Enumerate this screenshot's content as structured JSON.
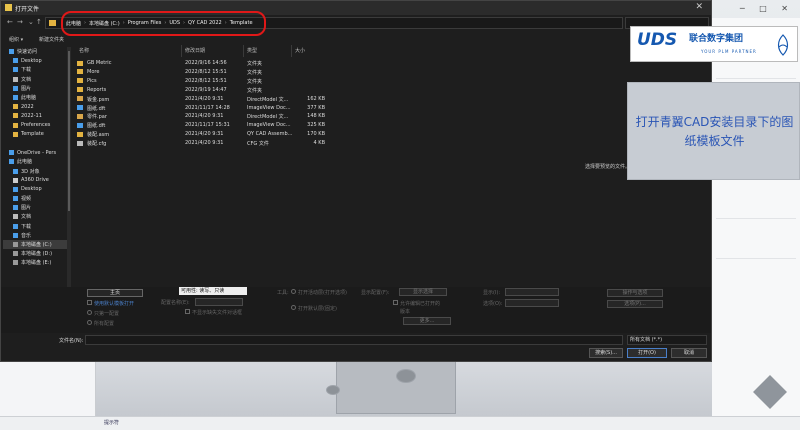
{
  "dialog": {
    "title": "打开文件",
    "close_glyph": "✕"
  },
  "nav": {
    "back": "←",
    "forward": "→",
    "dropdown": "⌄",
    "up": "↑"
  },
  "address": {
    "crumbs": [
      "此电脑",
      "本地磁盘 (C:)",
      "Program Files",
      "UDS",
      "QY CAD 2022",
      "Template"
    ],
    "separator": "›"
  },
  "commands": {
    "organize": "组织 ▾",
    "new_folder": "新建文件夹"
  },
  "nav_pane": {
    "items": [
      {
        "label": "快速访问",
        "icon": "star-icon",
        "color": "#4a9eea",
        "level": 0
      },
      {
        "label": "Desktop",
        "icon": "desktop-icon",
        "color": "#4a9eea",
        "level": 1
      },
      {
        "label": "下载",
        "icon": "download-icon",
        "color": "#4a9eea",
        "level": 1
      },
      {
        "label": "文档",
        "icon": "document-icon",
        "color": "#bbbbbb",
        "level": 1
      },
      {
        "label": "图片",
        "icon": "picture-icon",
        "color": "#4a9eea",
        "level": 1
      },
      {
        "label": "此电脑",
        "icon": "computer-icon",
        "color": "#4a9eea",
        "level": 1
      },
      {
        "label": "2022",
        "icon": "folder-icon",
        "color": "#e3b341",
        "level": 1
      },
      {
        "label": "2022-11",
        "icon": "folder-icon",
        "color": "#e3b341",
        "level": 1
      },
      {
        "label": "Preferences",
        "icon": "folder-icon",
        "color": "#e3b341",
        "level": 1
      },
      {
        "label": "Template",
        "icon": "folder-icon",
        "color": "#e3b341",
        "level": 1
      },
      {
        "label": "",
        "icon": "",
        "color": "",
        "level": 0
      },
      {
        "label": "OneDrive - Pers",
        "icon": "cloud-icon",
        "color": "#4a9eea",
        "level": 0
      },
      {
        "label": "此电脑",
        "icon": "computer-icon",
        "color": "#4a9eea",
        "level": 0
      },
      {
        "label": "3D 对象",
        "icon": "cube-icon",
        "color": "#4a9eea",
        "level": 1
      },
      {
        "label": "A360 Drive",
        "icon": "cloud-drive-icon",
        "color": "#cccccc",
        "level": 1
      },
      {
        "label": "Desktop",
        "icon": "desktop-icon",
        "color": "#4a9eea",
        "level": 1
      },
      {
        "label": "视频",
        "icon": "video-icon",
        "color": "#4a9eea",
        "level": 1
      },
      {
        "label": "图片",
        "icon": "picture-icon",
        "color": "#4a9eea",
        "level": 1
      },
      {
        "label": "文档",
        "icon": "document-icon",
        "color": "#bbbbbb",
        "level": 1
      },
      {
        "label": "下载",
        "icon": "download-icon",
        "color": "#4a9eea",
        "level": 1
      },
      {
        "label": "音乐",
        "icon": "music-icon",
        "color": "#4a9eea",
        "level": 1
      },
      {
        "label": "本地磁盘 (C:)",
        "icon": "drive-icon",
        "color": "#999999",
        "level": 1,
        "selected": true
      },
      {
        "label": "本地磁盘 (D:)",
        "icon": "drive-icon",
        "color": "#999999",
        "level": 1
      },
      {
        "label": "本地磁盘 (E:)",
        "icon": "drive-icon",
        "color": "#999999",
        "level": 1
      }
    ]
  },
  "file_list": {
    "columns": [
      "名称",
      "修改日期",
      "类型",
      "大小"
    ],
    "rows": [
      {
        "name": "GB Metric",
        "date": "2022/9/16 14:56",
        "type": "文件夹",
        "size": "",
        "icon": "folder-icon",
        "color": "#e3b341"
      },
      {
        "name": "More",
        "date": "2022/8/12 15:51",
        "type": "文件夹",
        "size": "",
        "icon": "folder-icon",
        "color": "#e3b341"
      },
      {
        "name": "Pics",
        "date": "2022/8/12 15:51",
        "type": "文件夹",
        "size": "",
        "icon": "folder-icon",
        "color": "#e3b341"
      },
      {
        "name": "Reports",
        "date": "2022/9/19 14:47",
        "type": "文件夹",
        "size": "",
        "icon": "folder-icon",
        "color": "#e3b341"
      },
      {
        "name": "钣金.psm",
        "date": "2021/4/20 9:31",
        "type": "DirectModel 文...",
        "size": "162 KB",
        "icon": "sheetmetal-file-icon",
        "color": "#d9a64a"
      },
      {
        "name": "图纸.dft",
        "date": "2021/11/17 14:28",
        "type": "ImageView Doc...",
        "size": "377 KB",
        "icon": "draft-file-icon",
        "color": "#4a9eea"
      },
      {
        "name": "零件.par",
        "date": "2021/4/20 9:31",
        "type": "DirectModel 文...",
        "size": "148 KB",
        "icon": "part-file-icon",
        "color": "#d9a64a"
      },
      {
        "name": "图纸.dft",
        "date": "2021/11/17 15:31",
        "type": "ImageView Doc...",
        "size": "325 KB",
        "icon": "draft-file-icon",
        "color": "#4a9eea"
      },
      {
        "name": "装配.asm",
        "date": "2021/4/20 9:31",
        "type": "QY CAD Assemb...",
        "size": "170 KB",
        "icon": "assembly-file-icon",
        "color": "#e3b341"
      },
      {
        "name": "装配.cfg",
        "date": "2021/4/20 9:31",
        "type": "CFG 文件",
        "size": "4 KB",
        "icon": "cfg-file-icon",
        "color": "#bbbbbb"
      }
    ]
  },
  "preview_msg": "选择要预览的文件。",
  "bottom": {
    "home_btn": "主页",
    "readonly": "可用性: 读写、只读",
    "use_default": "使用默认模板打开",
    "first_config": "只第一配置",
    "configs": "所有配置",
    "config_label": "配置名称(E):",
    "status_label": "状态:",
    "tools": "工具:",
    "r1": "打开活动层(打开选项)",
    "r2": "打开默认层(固定)",
    "shows_label": "显示配置(F):",
    "show_sel": "显示选择",
    "edit_cb": "允许编辑已打开的",
    "ver": "版本",
    "more": "更多...",
    "rec_cb": "不显示缺失文件对话框",
    "disp_label": "显示(I):",
    "bom_label": "选项(O):",
    "adv": "高级(A)...",
    "opts_btn": "操作与选项",
    "props_btn": "选项(P)..."
  },
  "filename": {
    "label": "文件名(N):",
    "value": ""
  },
  "file_type": "所有文档 (*.*)",
  "buttons": {
    "search": "搜索(S)...",
    "open": "打开(O)",
    "cancel": "取消"
  },
  "logo": {
    "mark": "UDS",
    "cn": "联合数字集团",
    "en": "YOUR PLM PARTNER"
  },
  "callout": "打开青翼CAD安装目录下的图纸模板文件",
  "status": {
    "hint": "提示符"
  }
}
